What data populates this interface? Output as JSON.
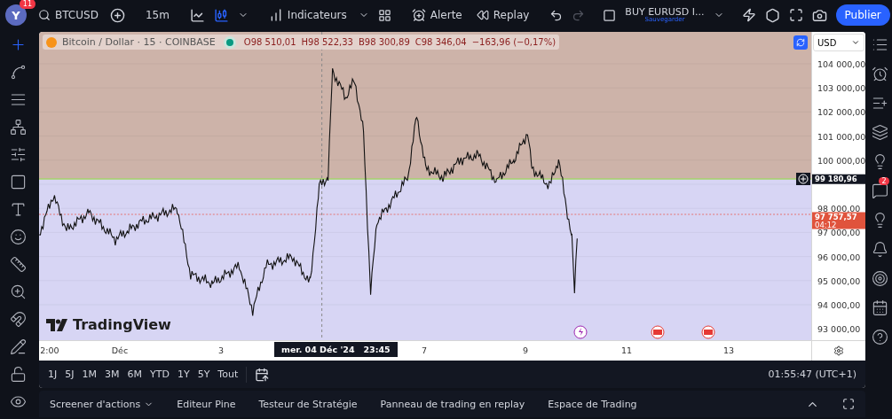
{
  "top_bar": {
    "avatar": {
      "letter": "Y",
      "badge": "11"
    },
    "symbol": "BTCUSD",
    "interval": "15m",
    "indicators": "Indicateurs",
    "alert": "Alerte",
    "replay": "Replay",
    "layout": {
      "name": "BUY EURUSD I...",
      "status": "Sauvegarder"
    },
    "publish": "Publier"
  },
  "left_toolbar": [
    {
      "selected": true
    },
    {
      "selected": false
    },
    {
      "selected": false
    },
    {
      "selected": false
    },
    {
      "selected": false
    },
    {
      "selected": false
    },
    {
      "selected": false
    },
    {
      "selected": false
    },
    {
      "selected": false
    },
    {
      "selected": false
    },
    {
      "selected": false
    },
    {
      "selected": false
    },
    {
      "selected": false
    },
    {
      "selected": false
    }
  ],
  "legend": {
    "title": "Bitcoin / Dollar · 15 · COINBASE",
    "ohlc": [
      {
        "label": "O",
        "value": "98 510,01"
      },
      {
        "label": "H",
        "value": "98 522,33"
      },
      {
        "label": "B",
        "value": "98 300,89"
      },
      {
        "label": "C",
        "value": "98 346,04"
      }
    ],
    "change": "−163,96 (−0,17%)"
  },
  "currency": "USD",
  "logo": "TradingView",
  "price_axis": {
    "ticks": [
      "104 000,00",
      "103 000,00",
      "102 000,00",
      "101 000,00",
      "100 000,00",
      "98 000,00",
      "97 000,00",
      "96 000,00",
      "95 000,00",
      "94 000,00",
      "93 000,00"
    ],
    "crosshair_price": "99 180,96",
    "last_price": "97 757,57",
    "countdown": "04:12"
  },
  "time_axis": {
    "ticks": [
      "2:00",
      "Déc",
      "3",
      "7",
      "9",
      "11",
      "13"
    ],
    "crosshair_time": "mer. 04 Déc '24   23:45"
  },
  "ranges": [
    "1J",
    "5J",
    "1M",
    "3M",
    "6M",
    "YTD",
    "1Y",
    "5Y",
    "Tout"
  ],
  "clock": "01:55:47 (UTC+1)",
  "bottom_tabs": [
    {
      "label": "Screener d'actions",
      "menu": true
    },
    {
      "label": "Editeur Pine",
      "menu": false
    },
    {
      "label": "Testeur de Stratégie",
      "menu": false
    },
    {
      "label": "Panneau de trading en replay",
      "menu": false
    },
    {
      "label": "Espace de Trading",
      "menu": false
    }
  ],
  "right_toolbar": {
    "chat_badge": "2"
  }
}
